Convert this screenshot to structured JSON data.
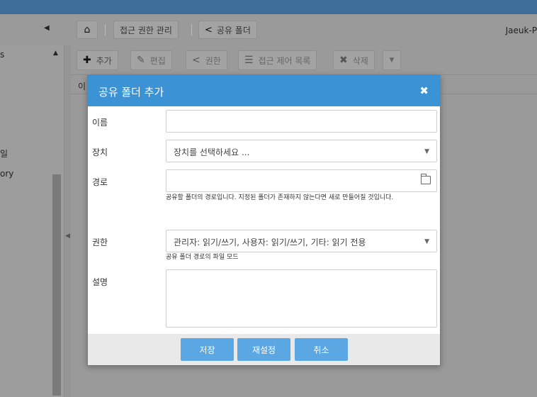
{
  "breadcrumb": {
    "home_icon": "home-icon",
    "access_label": "접근 권한 관리",
    "share_label": "공유 폴더"
  },
  "user": {
    "name": "Jaeuk-P"
  },
  "left_panel": {
    "items": [
      "s",
      "일",
      "ory"
    ]
  },
  "toolbar": {
    "add_label": "추가",
    "edit_label": "편집",
    "permission_label": "권한",
    "acl_label": "접근 제어 목록",
    "delete_label": "삭제"
  },
  "grid": {
    "first_column": "이"
  },
  "dialog": {
    "title": "공유 폴더 추가",
    "name_label": "이름",
    "name_value": "",
    "device_label": "장치",
    "device_placeholder": "장치를 선택하세요 ...",
    "path_label": "경로",
    "path_value": "",
    "path_hint": "공유할 폴더의 경로입니다. 지정된 폴더가 존재하지 않는다면 새로 만들어질 것입니다.",
    "permission_label": "권한",
    "permission_value": "관리자: 읽기/쓰기, 사용자: 읽기/쓰기, 기타: 읽기 전용",
    "permission_hint": "공유 폴더 경로의 파일 모드",
    "description_label": "설명",
    "description_value": "",
    "save_label": "저장",
    "reset_label": "재설정",
    "cancel_label": "취소"
  },
  "colors": {
    "header_bar": "#3d6d98",
    "dialog_header": "#3b93d6",
    "button": "#5aa7e3",
    "footer": "#e9e9e9"
  }
}
